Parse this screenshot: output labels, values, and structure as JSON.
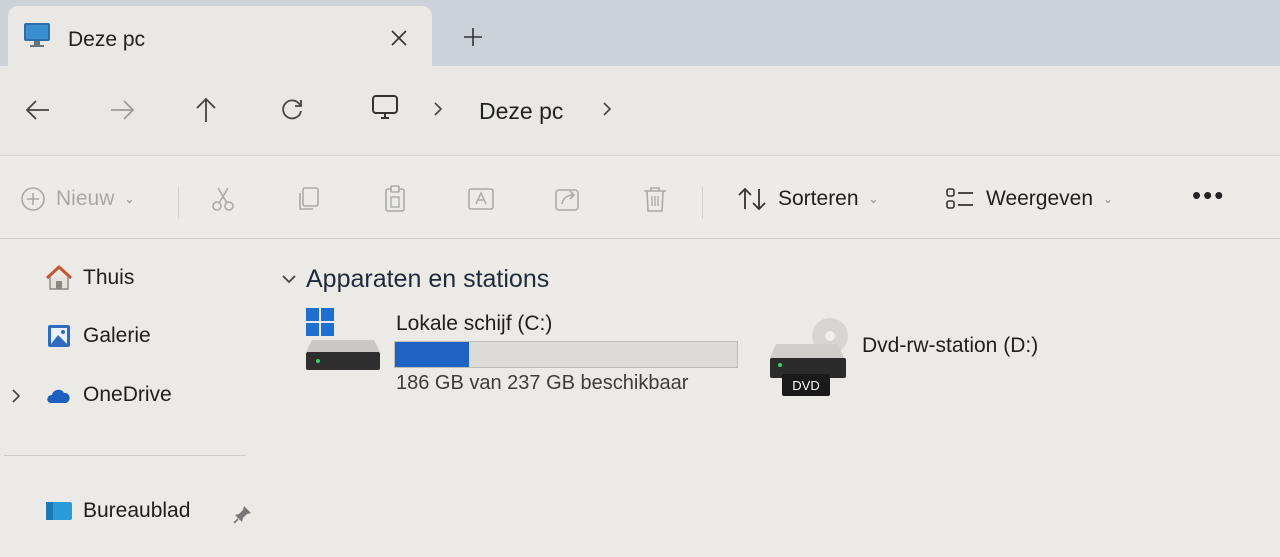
{
  "tab": {
    "title": "Deze pc",
    "icon": "computer-icon"
  },
  "nav": {
    "back": "arrow-left-icon",
    "forward": "arrow-right-icon",
    "up": "arrow-up-icon",
    "refresh": "refresh-icon",
    "breadcrumb": [
      "Deze pc"
    ]
  },
  "commands": {
    "new_label": "Nieuw",
    "sort_label": "Sorteren",
    "view_label": "Weergeven",
    "more": "•••"
  },
  "sidebar": {
    "items": [
      {
        "label": "Thuis",
        "icon": "home-icon"
      },
      {
        "label": "Galerie",
        "icon": "gallery-icon"
      },
      {
        "label": "OneDrive",
        "icon": "cloud-icon"
      },
      {
        "label": "Bureaublad",
        "icon": "desktop-icon"
      }
    ]
  },
  "section": {
    "title": "Apparaten en stations"
  },
  "drives": [
    {
      "name": "Lokale schijf (C:)",
      "free_text": "186 GB van 237 GB beschikbaar",
      "used_fraction": 0.215,
      "bar_color": "#1e63c4"
    },
    {
      "name": "Dvd-rw-station (D:)",
      "badge": "DVD"
    }
  ],
  "colors": {
    "accent": "#1e63c4",
    "tabbar": "#cdd2d8",
    "window": "#ecebe7"
  }
}
